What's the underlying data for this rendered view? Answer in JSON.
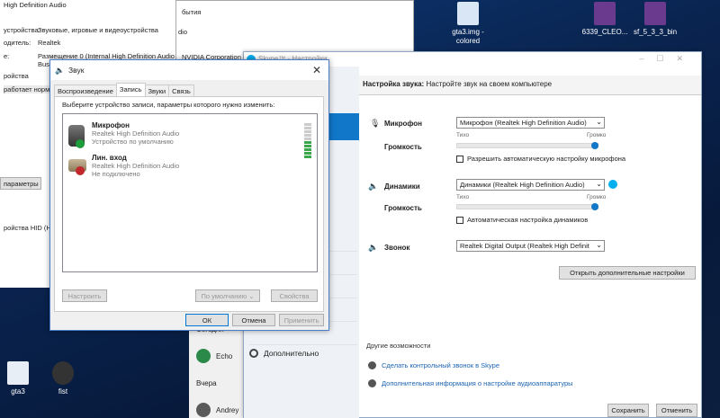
{
  "desktop": {
    "icons": [
      {
        "label": "gta3.img -\ncolored"
      },
      {
        "label": "6339_CLEO..."
      },
      {
        "label": "sf_5_3_3_bin"
      },
      {
        "label": "gta3"
      },
      {
        "label": "fist"
      }
    ]
  },
  "props": {
    "rows": [
      {
        "label": "High Definition Audio",
        "value": ""
      },
      {
        "label": "устройства:",
        "value": "Звуковые, игровые и видеоустройства"
      },
      {
        "label": "одитель:",
        "value": "Realtek"
      },
      {
        "label": "е:",
        "value": "Размещение 0 (Internal High Definition Audio"
      },
      {
        "label": "",
        "value": "Bus)"
      },
      {
        "label": "ройства",
        "value": ""
      },
      {
        "label": "работает нормаль",
        "value": ""
      }
    ],
    "button": "параметры",
    "hid_text": "ройства HID (H"
  },
  "mid": {
    "events": "бытия",
    "dio": "dio",
    "nvidia": "NVIDIA Corporation"
  },
  "skype": {
    "title": "Skype™ - Настройки",
    "header_bold": "Настройка звука:",
    "header_text": "Настройте звук на своем компьютере",
    "mic_label": "Микрофон",
    "mic_device": "Микрофон (Realtek High Definition Audio)",
    "quiet": "Тихо",
    "loud": "Громко",
    "volume_label": "Громкость",
    "mic_auto": "Разрешить автоматическую настройку микрофона",
    "speakers_label": "Динамики",
    "speakers_device": "Динамики (Realtek High Definition Audio)",
    "speakers_auto": "Автоматическая настройка динамиков",
    "ring_label": "Звонок",
    "ring_device": "Realtek Digital Output (Realtek High Definit",
    "advanced_button": "Открыть дополнительные настройки",
    "other_title": "Другие возможности",
    "link_test_call": "Сделать контрольный звонок в Skype",
    "link_more_info": "Дополнительная информация о настройке аудиоаппаратуры",
    "save": "Сохранить",
    "cancel": "Отменить",
    "nav_extra": "Дополнительно",
    "mic_volume": 1.0,
    "speakers_volume": 1.0
  },
  "contacts": {
    "today": "Сегодня",
    "echo": "Echo",
    "yesterday": "Вчера",
    "andrey": "Andrey"
  },
  "sound_dialog": {
    "title": "Звук",
    "tabs": [
      "Воспроизведение",
      "Запись",
      "Звуки",
      "Связь"
    ],
    "active_tab": 1,
    "instruction": "Выберите устройство записи, параметры которого нужно изменить:",
    "devices": [
      {
        "name": "Микрофон",
        "driver": "Realtek High Definition Audio",
        "status": "Устройство по умолчанию"
      },
      {
        "name": "Лин. вход",
        "driver": "Realtek High Definition Audio",
        "status": "Не подключено"
      }
    ],
    "configure": "Настроить",
    "default": "По умолчанию",
    "properties": "Свойства",
    "ok": "ОК",
    "cancel": "Отмена",
    "apply": "Применить",
    "mic_level": 0.45
  }
}
